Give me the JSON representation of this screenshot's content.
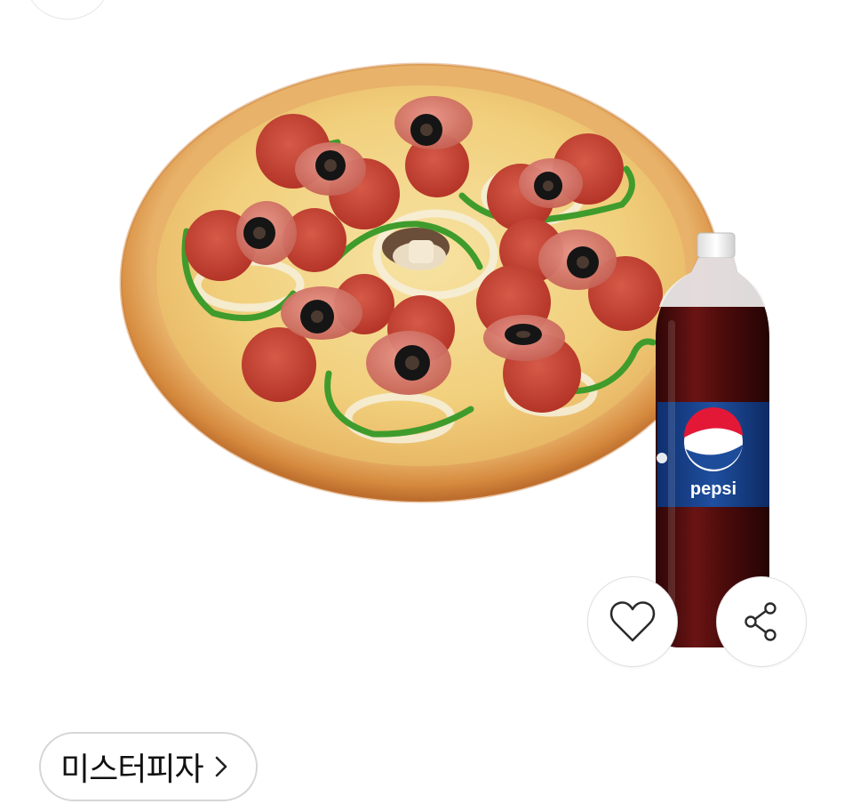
{
  "product": {
    "image_alt": "",
    "drink_logo_text": "pepsi"
  },
  "actions": {
    "like_icon": "heart-outline-icon",
    "share_icon": "share-icon"
  },
  "brand": {
    "label": "미스터피자",
    "chevron_icon": "chevron-right-icon"
  },
  "colors": {
    "pepsi_blue": "#1d4d9a",
    "pepsi_red": "#e31837",
    "cola": "#4a0d0d",
    "crust": "#d9954a",
    "cheese": "#f3d98a",
    "pepperoni": "#c2402f",
    "ham": "#d4706a",
    "olive": "#1a1a1a",
    "pepper": "#3f9c2c"
  }
}
